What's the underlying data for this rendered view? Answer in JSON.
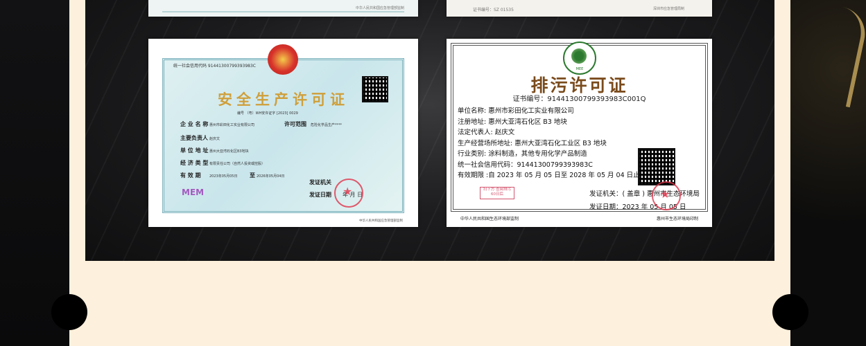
{
  "certificate1": {
    "title": "安全生产许可证",
    "code_line": "统一社会信用代码  91441300799393983C",
    "number_line": "编号  （粤）WH安许证字  [2023]  0029",
    "company_label": "企 业 名 称",
    "company_value": "惠州市彩田化工实业有限公司",
    "license_scope_label": "许可范围",
    "license_scope_value": "危险化学品生产****",
    "principal_label": "主要负责人",
    "principal_value": "赵庆文",
    "address_label": "单 位 地 址",
    "address_value": "惠州大亚湾石化区B3地块",
    "type_label": "经 济 类 型",
    "type_value": "有限责任公司（自然人投资或控股）",
    "valid_label": "有  效  期",
    "valid_from": "2023年05月05日",
    "valid_to_sep": "至",
    "valid_to": "2026年05月04日",
    "issuer_label": "发证机关",
    "date_label": "发证日期",
    "year_month_day": "年    月    日",
    "mark": "MEM",
    "footer": "中华人民共和国应急管理部监制"
  },
  "certificate2": {
    "logo_text": "MEE",
    "title": "排污许可证",
    "cert_no": "证书编号：91441300799393983C001Q",
    "fields": [
      "单位名称: 惠州市彩田化工实业有限公司",
      "注册地址: 惠州大亚湾石化区 B3 地块",
      "法定代表人: 赵庆文",
      "生产经营场所地址: 惠州大亚湾石化工业区 B3 地块",
      "行业类别: 涂料制造，其他专用化学产品制造",
      "统一社会信用代码：91441300799393983C",
      "有效期限 :自 2023 年 05 月 05 日至 2028 年 05 月 04 日止"
    ],
    "badge_text": "扫下方 查阅排污\n60日后",
    "issuer": "发证机关：( 盖章 ) 惠州市生态环境局",
    "issue_date": "发证日期：2023 年 05 月 05 日",
    "footer_left": "中华人民共和国生态环境部监制",
    "footer_right": "惠州市生态环境局印制"
  },
  "top_strip_left": {
    "footer": "中华人民共和国应急管理部监制"
  },
  "top_strip_right": {
    "cert_no": "证书编号：SZ      01535",
    "footer": "深圳市应急管理局制"
  }
}
